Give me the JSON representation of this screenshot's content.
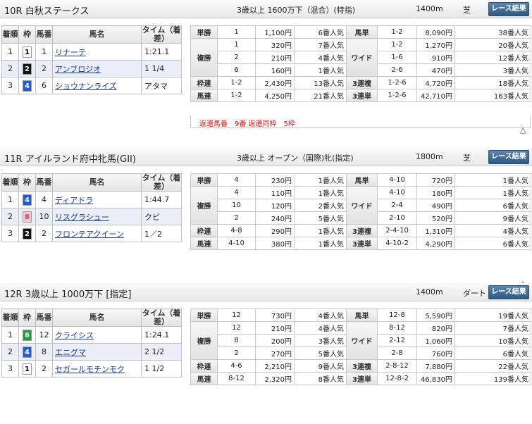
{
  "races": [
    {
      "title": "10R 白秋ステークス",
      "cond": "3歳以上 1600万下（混合）(特指)",
      "dist": "1400m",
      "surf": "芝",
      "button": "レース結果",
      "headers": {
        "rank": "着順",
        "waku": "枠",
        "num": "馬番",
        "name": "馬名",
        "time": "タイム（着差）"
      },
      "rows": [
        {
          "rank": "1",
          "waku": "1",
          "waku_bg": "#ffffff",
          "waku_fg": "#000000",
          "num": "1",
          "name": "リナーテ",
          "time": "1:21.1"
        },
        {
          "rank": "2",
          "waku": "2",
          "waku_bg": "#111111",
          "waku_fg": "#ffffff",
          "num": "2",
          "name": "アンブロジオ",
          "time": "1 1/4"
        },
        {
          "rank": "3",
          "waku": "4",
          "waku_bg": "#1e5bd8",
          "waku_fg": "#ffffff",
          "num": "6",
          "name": "ショウナンライズ",
          "time": "アタマ"
        }
      ],
      "pay": {
        "tansho": {
          "label": "単勝",
          "rows": [
            [
              "1",
              "1,100円",
              "6番人気"
            ]
          ]
        },
        "umatan": {
          "label": "馬単",
          "rows": [
            [
              "1-2",
              "8,090円",
              "38番人気"
            ]
          ]
        },
        "fukusho": {
          "label": "複勝",
          "rows": [
            [
              "1",
              "320円",
              "7番人気"
            ],
            [
              "2",
              "210円",
              "4番人気"
            ],
            [
              "6",
              "160円",
              "1番人気"
            ]
          ]
        },
        "wide": {
          "label": "ワイド",
          "rows": [
            [
              "1-2",
              "1,270円",
              "20番人気"
            ],
            [
              "1-6",
              "910円",
              "12番人気"
            ],
            [
              "2-6",
              "470円",
              "3番人気"
            ]
          ]
        },
        "wakuren": {
          "label": "枠連",
          "rows": [
            [
              "1-2",
              "2,430円",
              "13番人気"
            ]
          ]
        },
        "sanrenpuku": {
          "label": "3連複",
          "rows": [
            [
              "1-2-6",
              "4,720円",
              "18番人気"
            ]
          ]
        },
        "umaren": {
          "label": "馬連",
          "rows": [
            [
              "1-2",
              "4,250円",
              "21番人気"
            ]
          ]
        },
        "sanrentan": {
          "label": "3連単",
          "rows": [
            [
              "1-2-6",
              "42,710円",
              "163番人気"
            ]
          ]
        }
      },
      "note": "返還馬番　9番 返還同枠　5枠"
    },
    {
      "title": "11R アイルランド府中牝馬(GII)",
      "cond": "3歳以上 オープン（国際)牝(指定)",
      "dist": "1800m",
      "surf": "芝",
      "button": "レース結果",
      "headers": {
        "rank": "着順",
        "waku": "枠",
        "num": "馬番",
        "name": "馬名",
        "time": "タイム（着差）"
      },
      "rows": [
        {
          "rank": "1",
          "waku": "4",
          "waku_bg": "#1e5bd8",
          "waku_fg": "#ffffff",
          "num": "4",
          "name": "ディアドラ",
          "time": "1:44.7"
        },
        {
          "rank": "2",
          "waku": "8",
          "waku_bg": "#f7c6cf",
          "waku_fg": "#cc4466",
          "num": "10",
          "name": "リスグラシュー",
          "time": "クビ"
        },
        {
          "rank": "3",
          "waku": "2",
          "waku_bg": "#111111",
          "waku_fg": "#ffffff",
          "num": "2",
          "name": "フロンテアクイーン",
          "time": "1／2"
        }
      ],
      "pay": {
        "tansho": {
          "label": "単勝",
          "rows": [
            [
              "4",
              "230円",
              "1番人気"
            ]
          ]
        },
        "umatan": {
          "label": "馬単",
          "rows": [
            [
              "4-10",
              "720円",
              "1番人気"
            ]
          ]
        },
        "fukusho": {
          "label": "複勝",
          "rows": [
            [
              "4",
              "110円",
              "1番人気"
            ],
            [
              "10",
              "120円",
              "2番人気"
            ],
            [
              "2",
              "240円",
              "5番人気"
            ]
          ]
        },
        "wide": {
          "label": "ワイド",
          "rows": [
            [
              "4-10",
              "180円",
              "1番人気"
            ],
            [
              "2-4",
              "490円",
              "6番人気"
            ],
            [
              "2-10",
              "520円",
              "9番人気"
            ]
          ]
        },
        "wakuren": {
          "label": "枠連",
          "rows": [
            [
              "4-8",
              "290円",
              "1番人気"
            ]
          ]
        },
        "sanrenpuku": {
          "label": "3連複",
          "rows": [
            [
              "2-4-10",
              "1,310円",
              "4番人気"
            ]
          ]
        },
        "umaren": {
          "label": "馬連",
          "rows": [
            [
              "4-10",
              "380円",
              "1番人気"
            ]
          ]
        },
        "sanrentan": {
          "label": "3連単",
          "rows": [
            [
              "4-10-2",
              "4,290円",
              "6番人気"
            ]
          ]
        }
      },
      "note": ""
    },
    {
      "title": "12R 3歳以上 1000万下 [指定]",
      "cond": "",
      "dist": "1400m",
      "surf": "ダート",
      "button": "レース結果",
      "headers": {
        "rank": "着順",
        "waku": "枠",
        "num": "馬番",
        "name": "馬名",
        "time": "タイム（着差）"
      },
      "rows": [
        {
          "rank": "1",
          "waku": "6",
          "waku_bg": "#1f9a3a",
          "waku_fg": "#ffffff",
          "num": "12",
          "name": "クライシス",
          "time": "1:24.1"
        },
        {
          "rank": "2",
          "waku": "4",
          "waku_bg": "#1e5bd8",
          "waku_fg": "#ffffff",
          "num": "8",
          "name": "エニグマ",
          "time": "2 1/2"
        },
        {
          "rank": "3",
          "waku": "1",
          "waku_bg": "#ffffff",
          "waku_fg": "#000000",
          "num": "2",
          "name": "セガールモチンモク",
          "time": "1 1/2"
        }
      ],
      "pay": {
        "tansho": {
          "label": "単勝",
          "rows": [
            [
              "12",
              "730円",
              "4番人気"
            ]
          ]
        },
        "umatan": {
          "label": "馬単",
          "rows": [
            [
              "12-8",
              "5,590円",
              "19番人気"
            ]
          ]
        },
        "fukusho": {
          "label": "複勝",
          "rows": [
            [
              "12",
              "210円",
              "4番人気"
            ],
            [
              "8",
              "200円",
              "3番人気"
            ],
            [
              "2",
              "270円",
              "5番人気"
            ]
          ]
        },
        "wide": {
          "label": "ワイド",
          "rows": [
            [
              "8-12",
              "820円",
              "7番人気"
            ],
            [
              "2-12",
              "1,060円",
              "10番人気"
            ],
            [
              "2-8",
              "760円",
              "6番人気"
            ]
          ]
        },
        "wakuren": {
          "label": "枠連",
          "rows": [
            [
              "4-6",
              "2,210円",
              "9番人気"
            ]
          ]
        },
        "sanrenpuku": {
          "label": "3連複",
          "rows": [
            [
              "2-8-12",
              "7,880円",
              "22番人気"
            ]
          ]
        },
        "umaren": {
          "label": "馬連",
          "rows": [
            [
              "8-12",
              "2,320円",
              "8番人気"
            ]
          ]
        },
        "sanrentan": {
          "label": "3連単",
          "rows": [
            [
              "12-8-2",
              "46,830円",
              "139番人気"
            ]
          ]
        }
      },
      "note": ""
    }
  ],
  "up_symbol": "△"
}
